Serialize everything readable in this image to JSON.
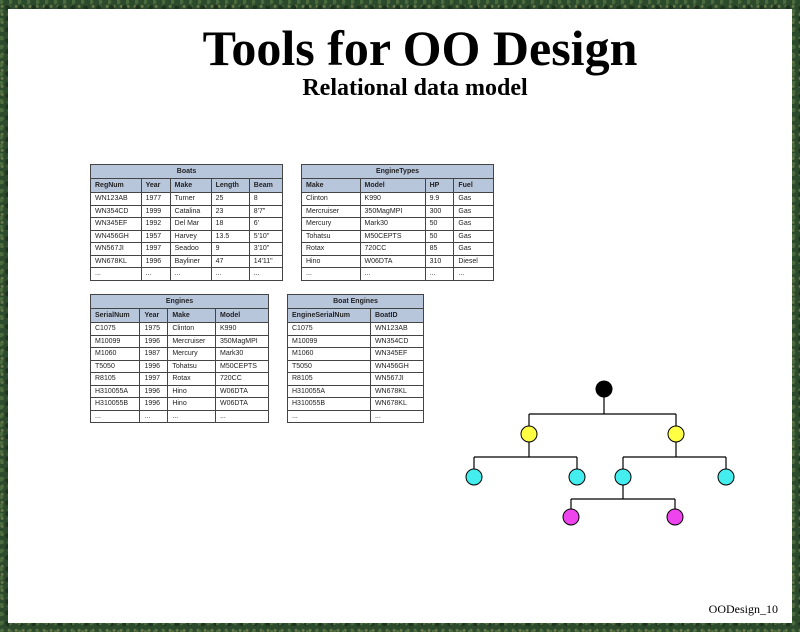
{
  "slide": {
    "title": "Tools for OO Design",
    "subtitle": "Relational data model",
    "footer": "OODesign_10"
  },
  "tables": {
    "boats": {
      "caption": "Boats",
      "headers": [
        "RegNum",
        "Year",
        "Make",
        "Length",
        "Beam"
      ],
      "rows": [
        [
          "WN123AB",
          "1977",
          "Turner",
          "25",
          "8"
        ],
        [
          "WN354CD",
          "1999",
          "Catalina",
          "23",
          "8'7\""
        ],
        [
          "WN345EF",
          "1992",
          "Del Mar",
          "18",
          "6'"
        ],
        [
          "WN456GH",
          "1957",
          "Harvey",
          "13.5",
          "5'10\""
        ],
        [
          "WN567JI",
          "1997",
          "Seadoo",
          "9",
          "3'10\""
        ],
        [
          "WN678KL",
          "1996",
          "Bayliner",
          "47",
          "14'11\""
        ],
        [
          "...",
          "...",
          "...",
          "...",
          "..."
        ]
      ]
    },
    "engine_types": {
      "caption": "EngineTypes",
      "headers": [
        "Make",
        "Model",
        "HP",
        "Fuel"
      ],
      "rows": [
        [
          "Clinton",
          "K990",
          "9.9",
          "Gas"
        ],
        [
          "Mercruiser",
          "350MagMPI",
          "300",
          "Gas"
        ],
        [
          "Mercury",
          "Mark30",
          "50",
          "Gas"
        ],
        [
          "Tohatsu",
          "M50CEPTS",
          "50",
          "Gas"
        ],
        [
          "Rotax",
          "720CC",
          "85",
          "Gas"
        ],
        [
          "Hino",
          "W06DTA",
          "310",
          "Diesel"
        ],
        [
          "...",
          "...",
          "...",
          "..."
        ]
      ]
    },
    "engines": {
      "caption": "Engines",
      "headers": [
        "SerialNum",
        "Year",
        "Make",
        "Model"
      ],
      "rows": [
        [
          "C1075",
          "1975",
          "Clinton",
          "K990"
        ],
        [
          "M10099",
          "1996",
          "Mercruiser",
          "350MagMPI"
        ],
        [
          "M1060",
          "1987",
          "Mercury",
          "Mark30"
        ],
        [
          "T5050",
          "1996",
          "Tohatsu",
          "M50CEPTS"
        ],
        [
          "R8105",
          "1997",
          "Rotax",
          "720CC"
        ],
        [
          "H310055A",
          "1996",
          "Hino",
          "W06DTA"
        ],
        [
          "H310055B",
          "1996",
          "Hino",
          "W06DTA"
        ],
        [
          "...",
          "...",
          "...",
          "..."
        ]
      ]
    },
    "boat_engines": {
      "caption": "Boat Engines",
      "headers": [
        "EngineSerialNum",
        "BoatID"
      ],
      "rows": [
        [
          "C1075",
          "WN123AB"
        ],
        [
          "M10099",
          "WN354CD"
        ],
        [
          "M1060",
          "WN345EF"
        ],
        [
          "T5050",
          "WN456GH"
        ],
        [
          "R8105",
          "WN567JI"
        ],
        [
          "H310055A",
          "WN678KL"
        ],
        [
          "H310055B",
          "WN678KL"
        ],
        [
          "...",
          "..."
        ]
      ]
    }
  },
  "tree": {
    "colors": {
      "root": "#000000",
      "level1": "#ffff44",
      "level2": "#44eeee",
      "level3": "#ee44ee",
      "line": "#000000"
    }
  }
}
